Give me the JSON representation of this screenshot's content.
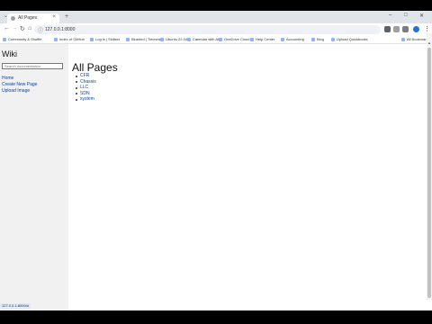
{
  "browser": {
    "tab_title": "All Pages",
    "new_tab": "+",
    "close_tab": "×",
    "url": "127.0.0.1:8000",
    "window_controls": {
      "minimize": "–",
      "maximize": "□",
      "close": "✕"
    },
    "bookmarks": [
      "Community & Shuffle",
      "Index of GitHub",
      "Log in | Skillset",
      "Bluebird | Timesheet",
      "Ubuntu 22.04",
      "Calendar with API",
      "OneDrive Cloud",
      "Help Center",
      "Accounting",
      "Blog",
      "Upload Quickbooks"
    ],
    "other_bookmarks": "All Bookmarks"
  },
  "sidebar": {
    "title": "Wiki",
    "search_placeholder": "Search documentation",
    "links": [
      "Home",
      "Create New Page",
      "Upload Image"
    ]
  },
  "main": {
    "heading": "All Pages",
    "pages": [
      "CFR",
      "Chassis",
      "LLC",
      "SDN",
      "system"
    ]
  },
  "status_bar": "127.0.0.1:8000/#"
}
